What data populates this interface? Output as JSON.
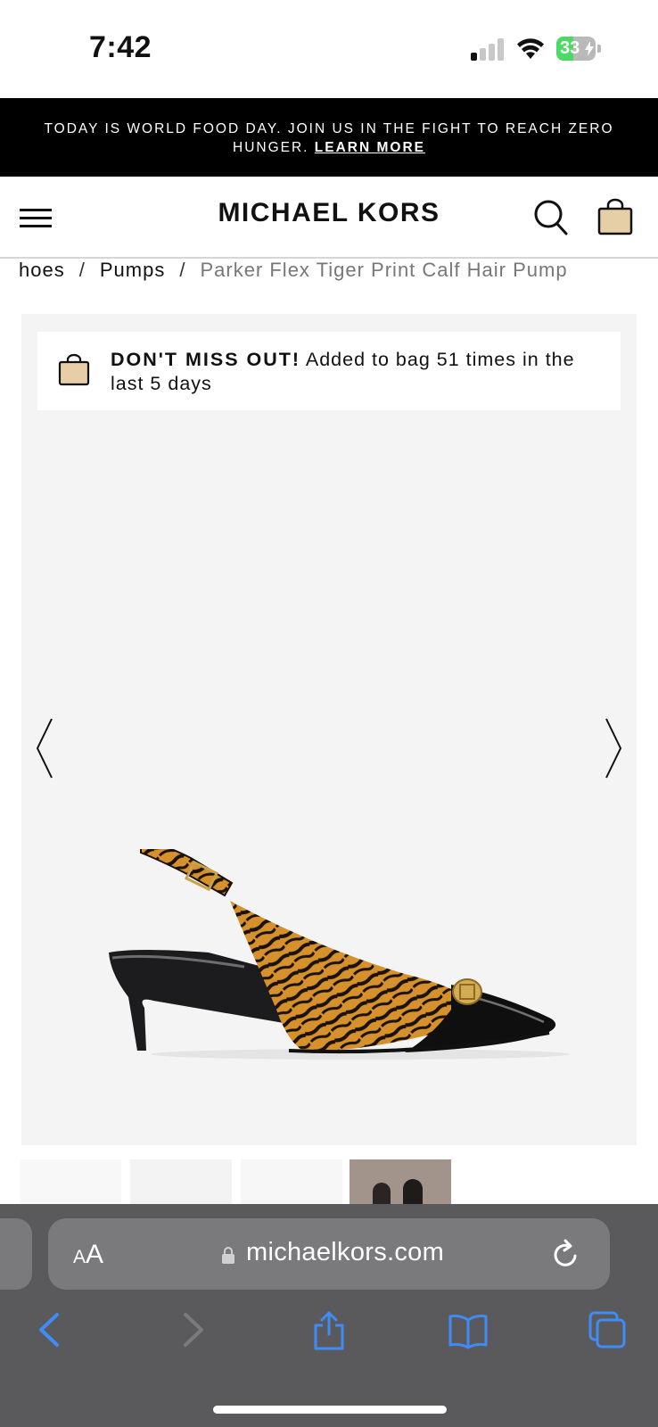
{
  "status_bar": {
    "time": "7:42",
    "battery": "33"
  },
  "promo": {
    "message": "TODAY IS WORLD FOOD DAY. JOIN US IN THE FIGHT TO REACH ZERO HUNGER. ",
    "link": "LEARN MORE"
  },
  "header": {
    "logo": "MICHAEL KORS"
  },
  "breadcrumb": {
    "items": [
      "hoes",
      "Pumps"
    ],
    "separator": "/",
    "current": "Parker Flex Tiger Print Calf Hair Pump"
  },
  "notice": {
    "strong": "DON'T MISS OUT!",
    "text": " Added to bag 51 times in the last 5 days"
  },
  "browser": {
    "url": "michaelkors.com",
    "aa_small": "A",
    "aa_large": "A"
  },
  "colors": {
    "bag_fill": "#e6cfa6",
    "accent_blue": "#3f8cf7",
    "battery_green": "#4cd964",
    "promo_bg": "#000000"
  },
  "icons": [
    "menu-icon",
    "search-icon",
    "shopping-bag-icon",
    "chevron-left-icon",
    "chevron-right-icon",
    "lock-icon",
    "reload-icon",
    "back-icon",
    "forward-icon",
    "share-icon",
    "bookmarks-icon",
    "tabs-icon"
  ]
}
